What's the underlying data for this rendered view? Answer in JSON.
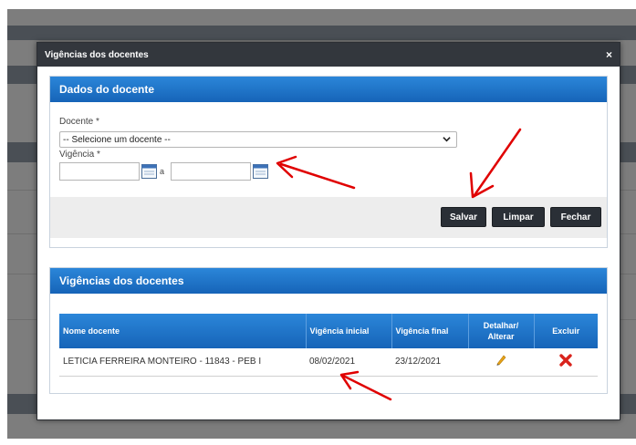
{
  "modal": {
    "title": "Vigências dos docentes",
    "close": "×"
  },
  "form_panel": {
    "title": "Dados do docente",
    "docente_label": "Docente *",
    "docente_select_value": "-- Selecione um docente --",
    "vigencia_label": "Vigência *",
    "date_separator": "a",
    "start_date_value": "",
    "end_date_value": ""
  },
  "buttons": {
    "salvar": "Salvar",
    "limpar": "Limpar",
    "fechar": "Fechar"
  },
  "list_panel": {
    "title": "Vigências dos docentes",
    "columns": [
      "Nome docente",
      "Vigência inicial",
      "Vigência final",
      "Detalhar/ Alterar",
      "Excluir"
    ],
    "rows": [
      {
        "nome": "LETICIA FERREIRA MONTEIRO - 11843 - PEB I",
        "vigencia_inicial": "08/02/2021",
        "vigencia_final": "23/12/2021",
        "detalhar_icon": "pencil-icon",
        "excluir_icon": "red-x-icon"
      }
    ]
  },
  "colors": {
    "panel_header": "#1f76cc",
    "modal_header": "#33373d",
    "button": "#2a2f36",
    "annotation_arrow": "#e00000",
    "delete_icon": "#d9231c",
    "edit_icon": "#e8a317"
  }
}
